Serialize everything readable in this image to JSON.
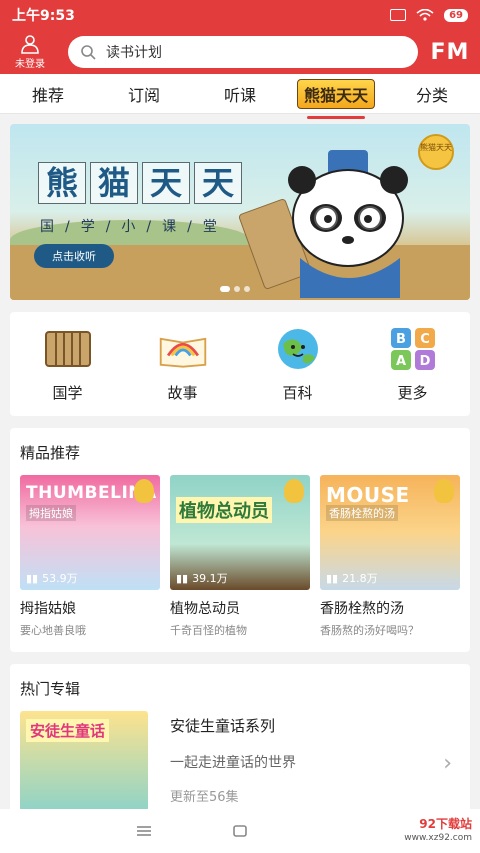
{
  "status_bar": {
    "time": "上午9:53",
    "battery": "69"
  },
  "header": {
    "user_label": "未登录",
    "search_placeholder": "读书计划",
    "fm_label": "FM"
  },
  "tabs": [
    {
      "label": "推荐"
    },
    {
      "label": "订阅"
    },
    {
      "label": "听课"
    },
    {
      "label": "熊猫天天",
      "active": true
    },
    {
      "label": "分类"
    }
  ],
  "banner": {
    "title_chars": [
      "熊",
      "猫",
      "天",
      "天"
    ],
    "subtitle": "国/学/小/课/堂",
    "button": "点击收听",
    "badge": "熊猫天天"
  },
  "categories": [
    {
      "label": "国学",
      "icon": "scroll-icon"
    },
    {
      "label": "故事",
      "icon": "rainbow-book-icon"
    },
    {
      "label": "百科",
      "icon": "earth-icon"
    },
    {
      "label": "更多",
      "icon": "abcd-blocks-icon"
    }
  ],
  "featured": {
    "title": "精品推荐",
    "items": [
      {
        "cover_en": "THUMBELINA",
        "cover_cn": "拇指姑娘",
        "plays": "53.9万",
        "name": "拇指姑娘",
        "desc": "要心地善良哦",
        "color": "#e04a8a"
      },
      {
        "cover_en": "",
        "cover_cn": "植物总动员",
        "plays": "39.1万",
        "name": "植物总动员",
        "desc": "千奇百怪的植物",
        "color": "#7bc7a0"
      },
      {
        "cover_en": "MOUSE",
        "cover_cn": "香肠栓熬的汤",
        "plays": "21.8万",
        "name": "香肠栓熬的汤",
        "desc": "香肠熬的汤好喝吗？",
        "color": "#f2a94a"
      }
    ]
  },
  "hot": {
    "title": "热门专辑",
    "album": {
      "cover_text": "安徒生童话",
      "name": "安徒生童话系列",
      "desc": "一起走进童话的世界",
      "update": "更新至56集"
    }
  },
  "watermark": {
    "site": "92下载站",
    "url": "www.xz92.com"
  },
  "colors": {
    "brand_red": "#e23c3c"
  }
}
